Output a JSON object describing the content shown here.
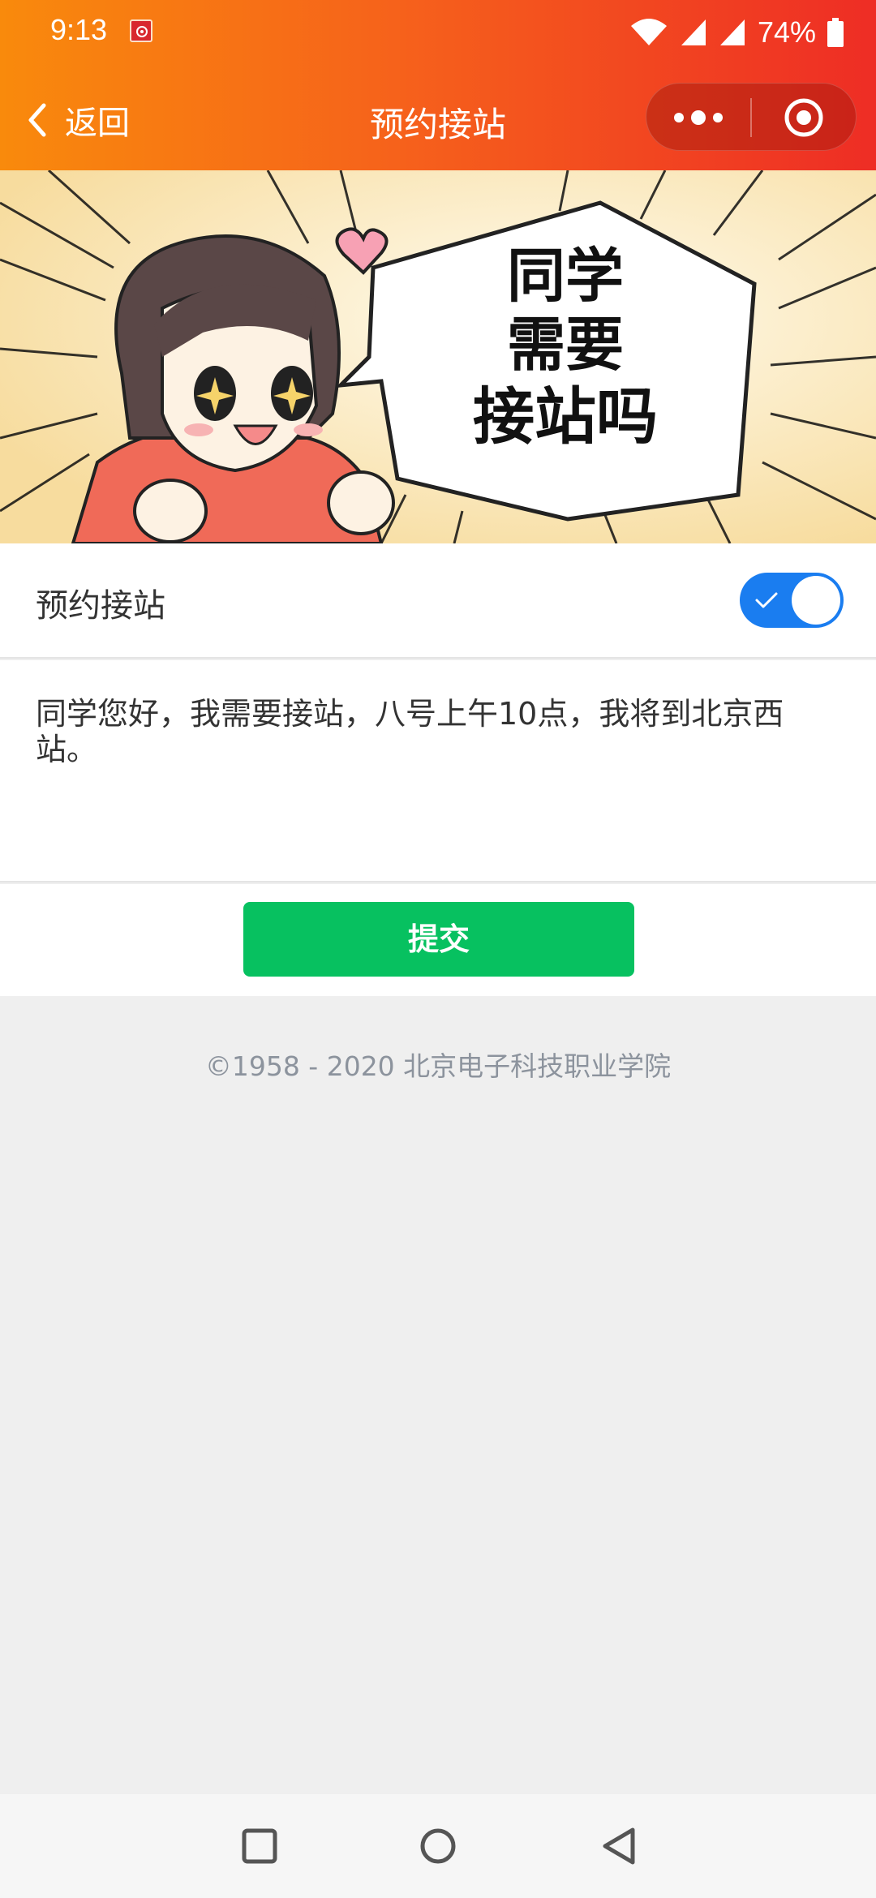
{
  "status_bar": {
    "time": "9:13",
    "battery": "74%",
    "icons": [
      "app-notification-icon",
      "wifi-icon",
      "signal-icon",
      "signal-icon",
      "battery-icon"
    ]
  },
  "nav": {
    "back_label": "返回",
    "title": "预约接站"
  },
  "banner": {
    "speech_lines": [
      "同学",
      "需要",
      "接站吗"
    ]
  },
  "form": {
    "switch_label": "预约接站",
    "switch_on": true,
    "message": "同学您好，我需要接站，八号上午10点，我将到北京西站。",
    "submit_label": "提交"
  },
  "footer": {
    "copyright": "©1958 - 2020 北京电子科技职业学院"
  },
  "colors": {
    "header_start": "#f98a0c",
    "header_end": "#ee2d25",
    "toggle_on": "#1a7df0",
    "submit": "#07c160"
  }
}
